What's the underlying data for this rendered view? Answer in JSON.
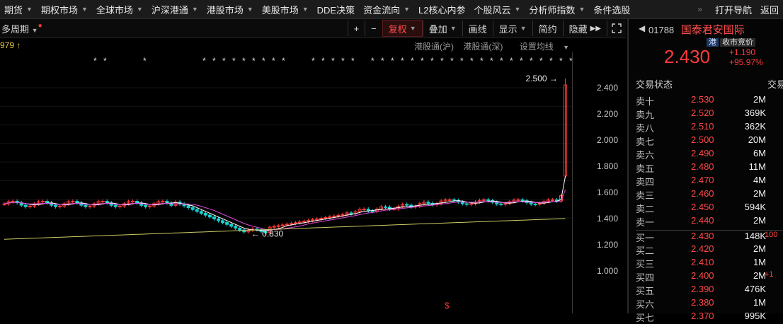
{
  "topbar": {
    "items": [
      {
        "label": "期货"
      },
      {
        "label": "期权市场"
      },
      {
        "label": "全球市场"
      },
      {
        "label": "沪深港通"
      },
      {
        "label": "港股市场"
      },
      {
        "label": "美股市场"
      },
      {
        "label": "DDE决策"
      },
      {
        "label": "资金流向"
      },
      {
        "label": "L2核心内参"
      },
      {
        "label": "个股风云"
      },
      {
        "label": "分析师指数"
      },
      {
        "label": "条件选股"
      }
    ],
    "more": "»",
    "open_nav": "打开导航",
    "back": "返回"
  },
  "toolbar": {
    "period": "多周期",
    "plus": "+",
    "minus": "−",
    "fuquan": "复权",
    "overlay": "叠加",
    "draw_line": "画线",
    "display": "显示",
    "simple": "简约",
    "hide": "隐藏"
  },
  "legend": {
    "value": "979",
    "link_sh": "港股通(沪)",
    "link_sz": "港股通(深)",
    "set_ma": "设置均线"
  },
  "chart": {
    "y_ticks": [
      "2.400",
      "2.200",
      "2.000",
      "1.800",
      "1.600",
      "1.400",
      "1.200",
      "1.000"
    ],
    "high_label": "2.500",
    "low_label": "0.830"
  },
  "chart_data": {
    "type": "candlestick",
    "y_ticks": [
      1.0,
      1.2,
      1.4,
      1.6,
      1.8,
      2.0,
      2.2,
      2.4
    ],
    "annotated_high": 2.5,
    "annotated_low": 0.83,
    "last_close": 2.43,
    "colors": {
      "up": "#ff3b3b",
      "down": "#18d1d1",
      "ma5": "#ffffff",
      "ma10": "#d848d8",
      "ma60": "#cccc66"
    }
  },
  "quote": {
    "code": "01788",
    "name": "国泰君安国际",
    "market_tag": "港",
    "auction_tag": "收市竞价",
    "price": "2.430",
    "change": "+1.190",
    "change_pct": "+95.97%",
    "status_label": "交易状态",
    "status_right": "交易",
    "asks": [
      {
        "label": "卖十",
        "price": "2.530",
        "vol": "2M"
      },
      {
        "label": "卖九",
        "price": "2.520",
        "vol": "369K"
      },
      {
        "label": "卖八",
        "price": "2.510",
        "vol": "362K"
      },
      {
        "label": "卖七",
        "price": "2.500",
        "vol": "20M"
      },
      {
        "label": "卖六",
        "price": "2.490",
        "vol": "6M"
      },
      {
        "label": "卖五",
        "price": "2.480",
        "vol": "11M"
      },
      {
        "label": "卖四",
        "price": "2.470",
        "vol": "4M"
      },
      {
        "label": "卖三",
        "price": "2.460",
        "vol": "2M"
      },
      {
        "label": "卖二",
        "price": "2.450",
        "vol": "594K"
      },
      {
        "label": "卖一",
        "price": "2.440",
        "vol": "2M"
      }
    ],
    "bids": [
      {
        "label": "买一",
        "price": "2.430",
        "vol": "148K",
        "extra": "100"
      },
      {
        "label": "买二",
        "price": "2.420",
        "vol": "2M",
        "extra": ""
      },
      {
        "label": "买三",
        "price": "2.410",
        "vol": "1M",
        "extra": ""
      },
      {
        "label": "买四",
        "price": "2.400",
        "vol": "2M",
        "extra": "+1"
      },
      {
        "label": "买五",
        "price": "2.390",
        "vol": "476K",
        "extra": ""
      },
      {
        "label": "买六",
        "price": "2.380",
        "vol": "1M",
        "extra": ""
      },
      {
        "label": "买七",
        "price": "2.370",
        "vol": "995K",
        "extra": ""
      }
    ]
  }
}
